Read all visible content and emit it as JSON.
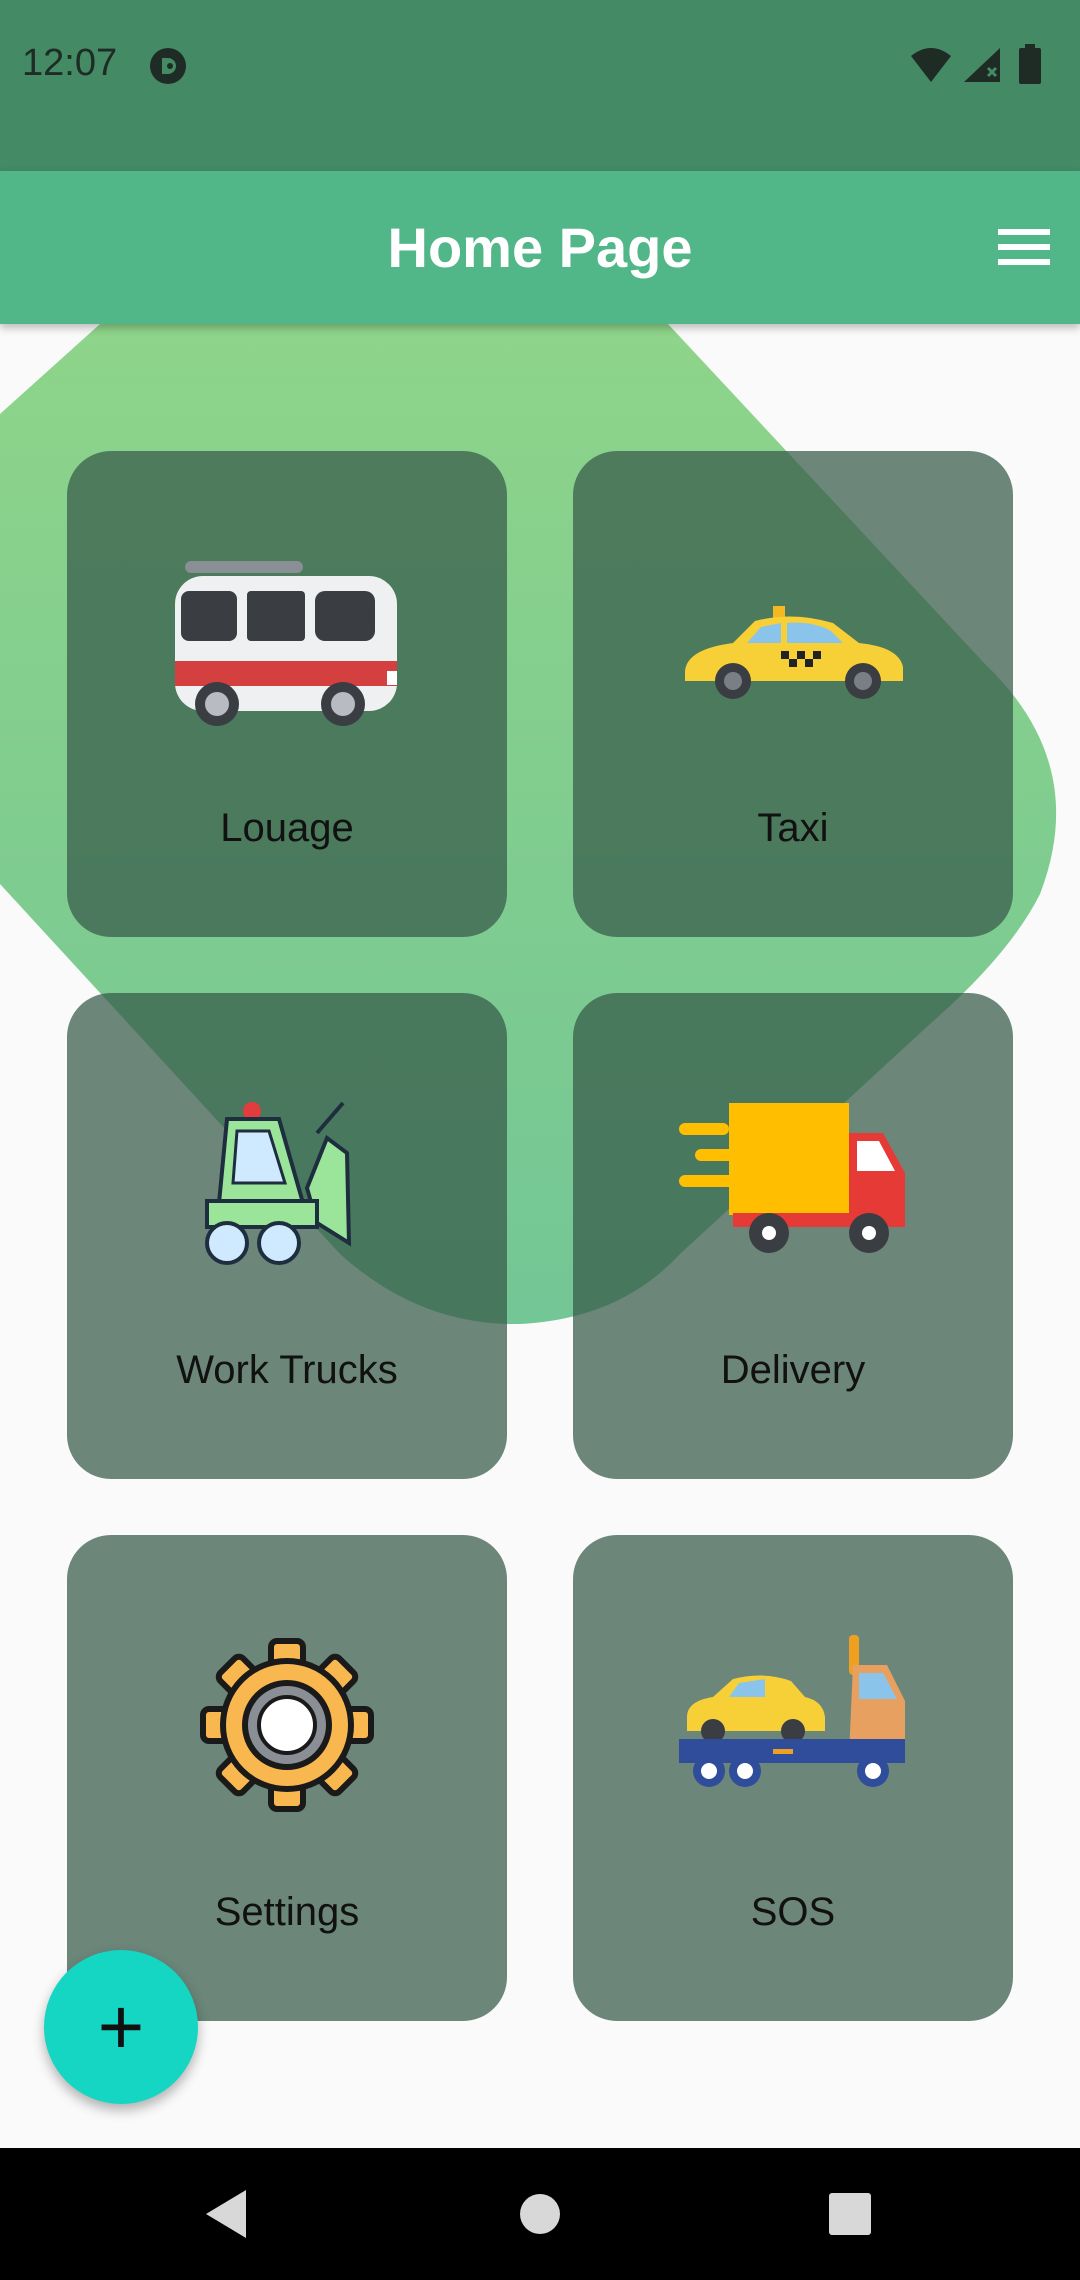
{
  "status_bar": {
    "time": "12:07",
    "icons": [
      "app-notification-icon",
      "wifi-icon",
      "cell-signal-icon",
      "battery-icon"
    ]
  },
  "app_bar": {
    "title": "Home Page",
    "menu_icon": "hamburger-menu-icon"
  },
  "cards": [
    {
      "label": "Louage",
      "icon": "minibus-icon"
    },
    {
      "label": "Taxi",
      "icon": "taxi-icon"
    },
    {
      "label": "Work Trucks",
      "icon": "bulldozer-icon"
    },
    {
      "label": "Delivery",
      "icon": "delivery-truck-icon"
    },
    {
      "label": "Settings",
      "icon": "gear-icon"
    },
    {
      "label": "SOS",
      "icon": "tow-truck-icon"
    }
  ],
  "fab": {
    "label": "+",
    "icon": "plus-icon"
  },
  "nav_bar": {
    "icons": [
      "back-icon",
      "home-icon",
      "recents-icon"
    ]
  },
  "colors": {
    "status_bar": "#438a65",
    "app_bar": "#52b788",
    "blob": "#86d08a",
    "card": "#375b4a",
    "fab": "#14d6c3"
  }
}
